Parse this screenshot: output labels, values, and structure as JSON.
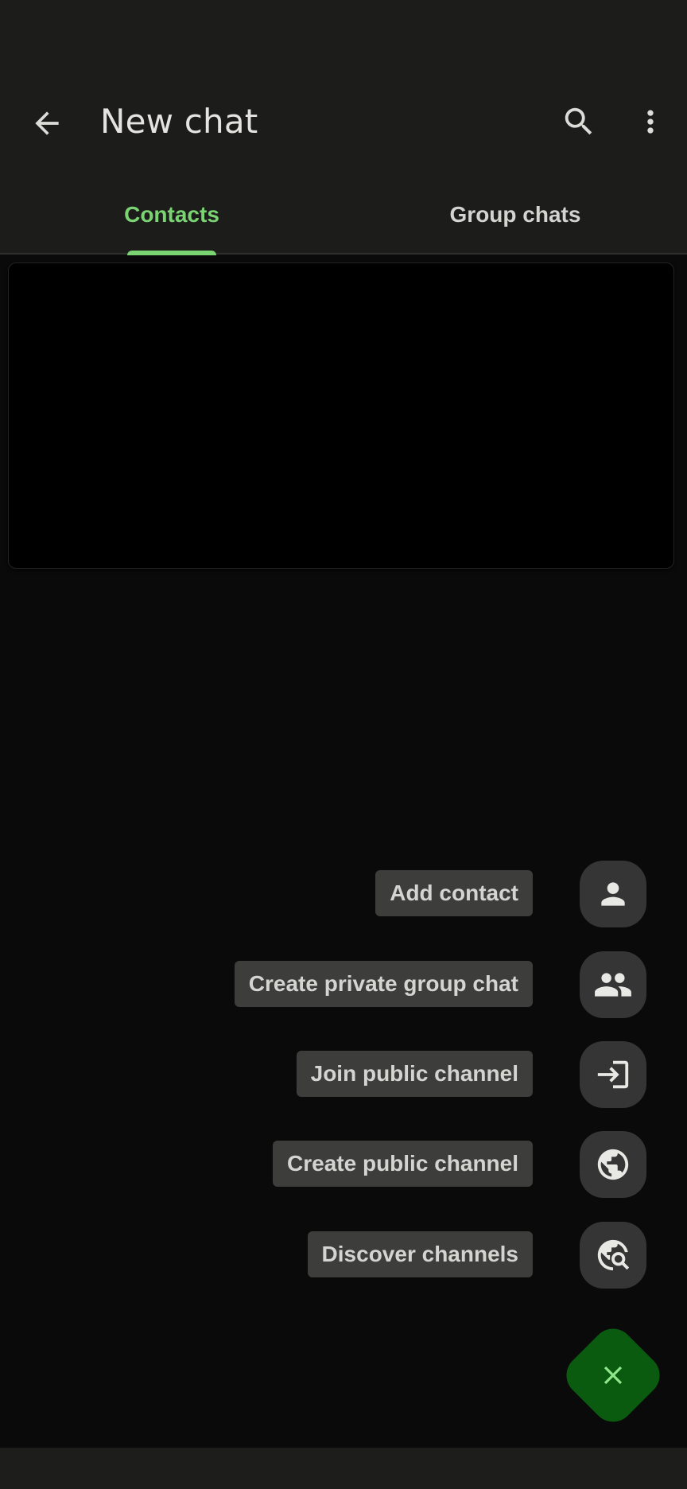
{
  "app_bar": {
    "title": "New chat",
    "back_icon": "arrow-back-icon",
    "search_icon": "search-icon",
    "more_icon": "more-vert-icon"
  },
  "tabs": [
    {
      "label": "Contacts",
      "selected": true
    },
    {
      "label": "Group chats",
      "selected": false
    }
  ],
  "speed_dial": {
    "items": [
      {
        "label": "Add contact",
        "icon": "person-icon"
      },
      {
        "label": "Create private group chat",
        "icon": "group-icon"
      },
      {
        "label": "Join public channel",
        "icon": "login-icon"
      },
      {
        "label": "Create public channel",
        "icon": "globe-icon"
      },
      {
        "label": "Discover channels",
        "icon": "travel-explore-icon"
      }
    ],
    "close_icon": "close-icon"
  },
  "colors": {
    "accent": "#7ad472",
    "fab_background": "#0a5a10",
    "top_bar": "#1c1d1b",
    "background": "#0a0a0a",
    "label_chip": "#3d3d3c",
    "icon_button": "#353536"
  }
}
